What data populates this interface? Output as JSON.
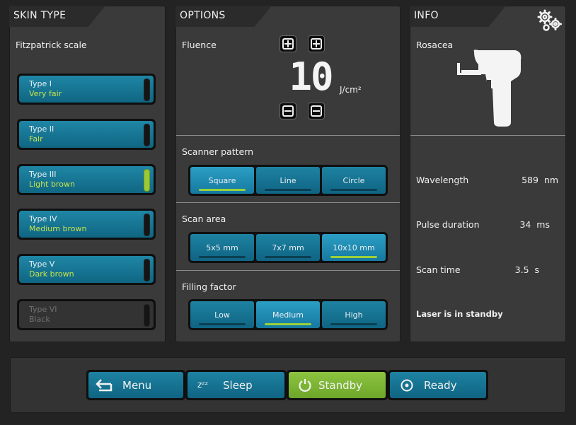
{
  "skin": {
    "title": "SKIN TYPE",
    "scale_label": "Fitzpatrick scale",
    "types": [
      {
        "name": "Type I",
        "desc": "Very fair"
      },
      {
        "name": "Type II",
        "desc": "Fair"
      },
      {
        "name": "Type III",
        "desc": "Light brown"
      },
      {
        "name": "Type IV",
        "desc": "Medium brown"
      },
      {
        "name": "Type V",
        "desc": "Dark brown"
      },
      {
        "name": "Type VI",
        "desc": "Black"
      }
    ],
    "selected_index": 2,
    "disabled_index": 5
  },
  "options": {
    "title": "OPTIONS",
    "fluence_label": "Fluence",
    "fluence_value": "10",
    "fluence_unit": "J/cm²",
    "scanner_pattern": {
      "label": "Scanner pattern",
      "options": [
        "Square",
        "Line",
        "Circle"
      ],
      "selected": "Square"
    },
    "scan_area": {
      "label": "Scan area",
      "options": [
        "5x5 mm",
        "7x7 mm",
        "10x10 mm"
      ],
      "selected": "10x10 mm"
    },
    "filling_factor": {
      "label": "Filling factor",
      "options": [
        "Low",
        "Medium",
        "High"
      ],
      "selected": "Medium"
    }
  },
  "info": {
    "title": "INFO",
    "treatment": "Rosacea",
    "rows": [
      {
        "label": "Wavelength",
        "value": "589",
        "unit": "nm"
      },
      {
        "label": "Pulse duration",
        "value": "34",
        "unit": "ms"
      },
      {
        "label": "Scan time",
        "value": "3.5",
        "unit": "s"
      }
    ],
    "status": "Laser is in standby"
  },
  "bottom": {
    "menu": "Menu",
    "sleep": "Sleep",
    "sleep_icon_text": "zᶻᶻ",
    "standby": "Standby",
    "ready": "Ready",
    "active": "Standby"
  },
  "colors": {
    "accent_blue": "#1679a0",
    "active_green": "#9bd03a",
    "standby_green": "#7ab532"
  }
}
